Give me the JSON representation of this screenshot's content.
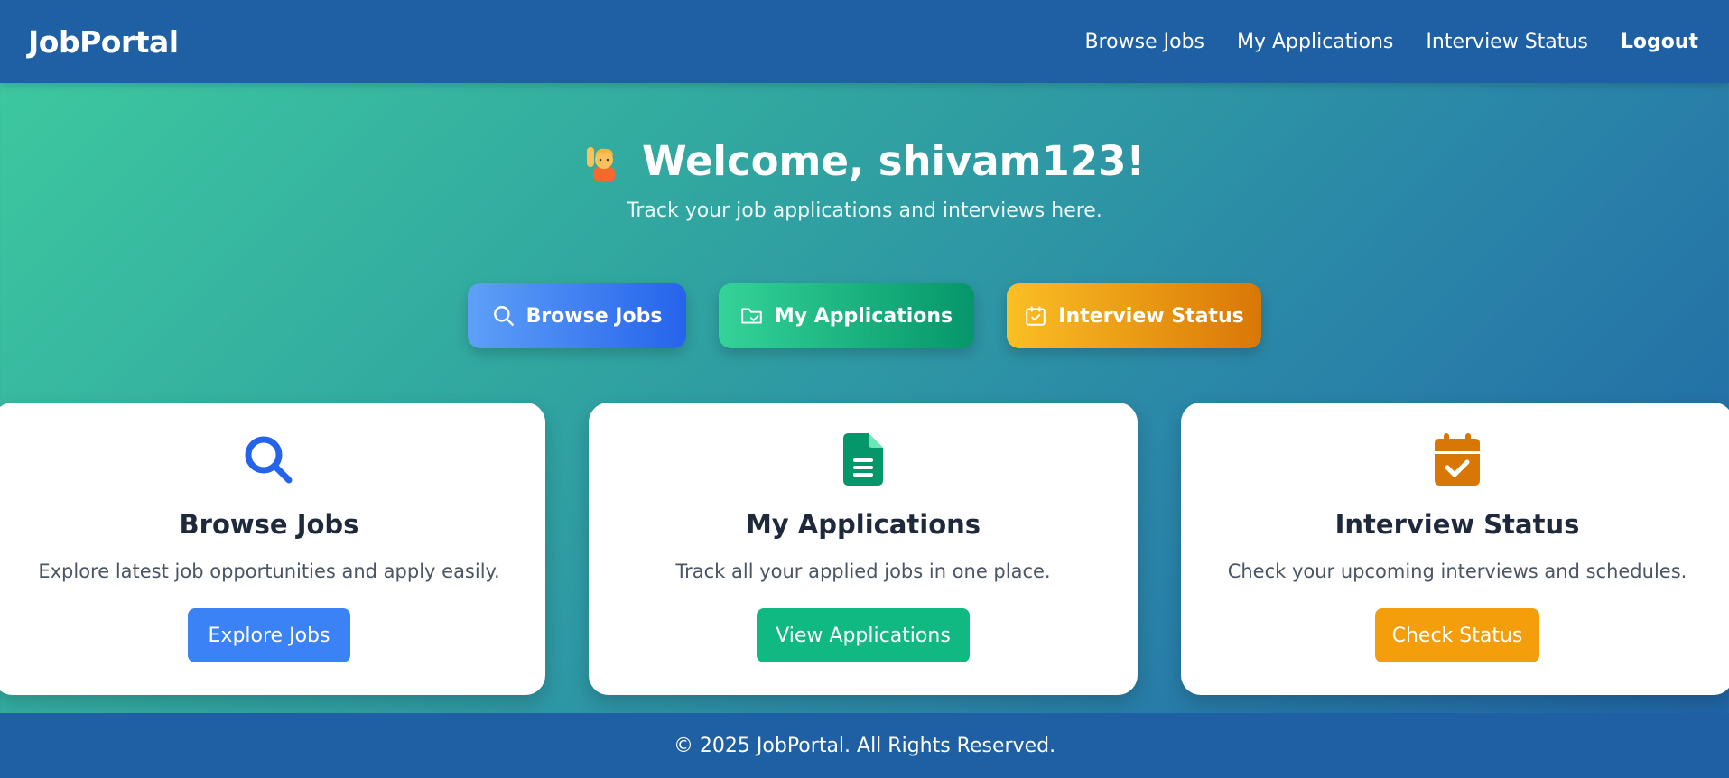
{
  "navbar": {
    "brand": "JobPortal",
    "links": [
      {
        "label": "Browse Jobs"
      },
      {
        "label": "My Applications"
      },
      {
        "label": "Interview Status"
      },
      {
        "label": "Logout"
      }
    ]
  },
  "hero": {
    "icon": "waving-person-icon",
    "title": "Welcome, shivam123!",
    "subtitle": "Track your job applications and interviews here."
  },
  "actions": [
    {
      "label": "Browse Jobs",
      "icon": "search-icon",
      "color": "#2563eb"
    },
    {
      "label": "My Applications",
      "icon": "folder-check-icon",
      "color": "#059669"
    },
    {
      "label": "Interview Status",
      "icon": "calendar-check-icon",
      "color": "#d97706"
    }
  ],
  "cards": [
    {
      "icon": "search-icon",
      "title": "Browse Jobs",
      "description": "Explore latest job opportunities and apply easily.",
      "button": "Explore Jobs",
      "color": "#3b82f6"
    },
    {
      "icon": "document-icon",
      "title": "My Applications",
      "description": "Track all your applied jobs in one place.",
      "button": "View Applications",
      "color": "#10b981"
    },
    {
      "icon": "calendar-check-icon",
      "title": "Interview Status",
      "description": "Check your upcoming interviews and schedules.",
      "button": "Check Status",
      "color": "#f59e0b"
    }
  ],
  "footer": {
    "text": "© 2025 JobPortal. All Rights Reserved."
  }
}
